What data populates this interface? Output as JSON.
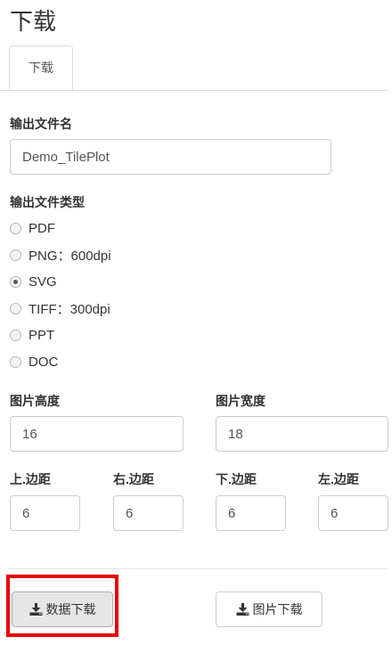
{
  "page": {
    "title": "下载"
  },
  "tabs": [
    {
      "label": "下载",
      "active": true
    }
  ],
  "output_filename": {
    "label": "输出文件名",
    "value": "Demo_TilePlot"
  },
  "file_type": {
    "label": "输出文件类型",
    "selected": "SVG",
    "options": [
      {
        "label": "PDF",
        "checked": false
      },
      {
        "label": "PNG：600dpi",
        "checked": false
      },
      {
        "label": "SVG",
        "checked": true
      },
      {
        "label": "TIFF：300dpi",
        "checked": false
      },
      {
        "label": "PPT",
        "checked": false
      },
      {
        "label": "DOC",
        "checked": false
      }
    ]
  },
  "image_size": {
    "height_label": "图片高度",
    "height_value": "16",
    "width_label": "图片宽度",
    "width_value": "18"
  },
  "margins": {
    "top_label": "上.边距",
    "top_value": "6",
    "right_label": "右.边距",
    "right_value": "6",
    "bottom_label": "下.边距",
    "bottom_value": "6",
    "left_label": "左.边距",
    "left_value": "6"
  },
  "buttons": {
    "data_download": {
      "label": "数据下载",
      "icon": "download-icon"
    },
    "image_download": {
      "label": "图片下载",
      "icon": "download-icon"
    }
  },
  "colors": {
    "highlight": "#e60000",
    "border": "#cccccc",
    "text": "#333333"
  }
}
